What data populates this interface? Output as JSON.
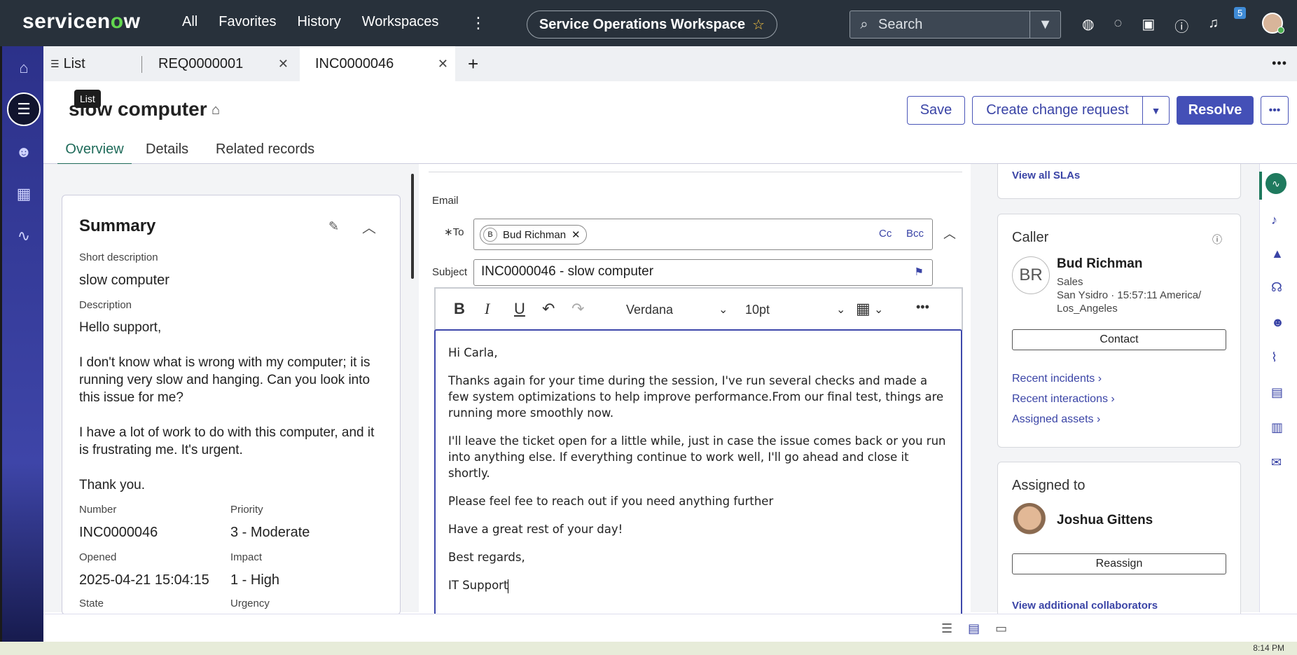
{
  "topbar": {
    "logo_pre": "servicen",
    "logo_o": "o",
    "logo_post": "w",
    "nav": [
      "All",
      "Favorites",
      "History",
      "Workspaces"
    ],
    "workspace": "Service Operations Workspace",
    "search_placeholder": "Search",
    "notification_count": "5"
  },
  "tabs": {
    "list_label": "List",
    "tab1": "REQ0000001",
    "tab2": "INC0000046",
    "tooltip": "List"
  },
  "record": {
    "title": "slow computer",
    "buttons": {
      "save": "Save",
      "create_change": "Create change request",
      "resolve": "Resolve"
    },
    "subtabs": [
      "Overview",
      "Details",
      "Related records"
    ]
  },
  "summary": {
    "title": "Summary",
    "short_desc_label": "Short description",
    "short_desc": "slow computer",
    "desc_label": "Description",
    "description": "Hello support,\n\nI don't know what is wrong with my computer; it is running very slow and hanging. Can you look into this issue for me?\n\nI have a lot of work to do with this computer, and it is frustrating me. It's urgent.\n\nThank you.",
    "number_label": "Number",
    "number": "INC0000046",
    "priority_label": "Priority",
    "priority": "3 - Moderate",
    "opened_label": "Opened",
    "opened": "2025-04-21 15:04:15",
    "impact_label": "Impact",
    "impact": "1 - High",
    "state_label": "State",
    "urgency_label": "Urgency"
  },
  "email": {
    "section_label": "Email",
    "to_label": "∗To",
    "to_initial": "B",
    "to_name": "Bud Richman",
    "cc": "Cc",
    "bcc": "Bcc",
    "subject_label": "Subject",
    "subject": "INC0000046 - slow computer",
    "font": "Verdana",
    "size": "10pt",
    "body": [
      "Hi Carla,",
      "Thanks again for your time during the session, I've run several checks and made a few system optimizations to help improve performance.From our final test, things are running more smoothly now.",
      "I'll leave the ticket open for a little while, just in case the issue comes back or you run into anything else. If everything continue to work well, I'll go ahead and close it shortly.",
      "Please feel fee to reach out if you need anything further",
      "Have a great rest of your day!",
      "Best regards,",
      "IT Support"
    ]
  },
  "right": {
    "view_slas": "View all SLAs",
    "caller_title": "Caller",
    "caller_initials": "BR",
    "caller_name": "Bud Richman",
    "caller_dept": "Sales",
    "caller_loc": "San Ysidro · 15:57:11 America/",
    "caller_tz": "Los_Angeles",
    "contact": "Contact",
    "recent_incidents": "Recent incidents",
    "recent_interactions": "Recent interactions",
    "assigned_assets": "Assigned assets",
    "assigned_title": "Assigned to",
    "assignee": "Joshua Gittens",
    "reassign": "Reassign",
    "collaborators": "View additional collaborators"
  },
  "taskbar": {
    "clock": "8:14 PM"
  },
  "colors": {
    "topbar": "#28313b",
    "rail": "#3e45a8",
    "primary": "#4450b7",
    "accent_green": "#62d84e"
  }
}
